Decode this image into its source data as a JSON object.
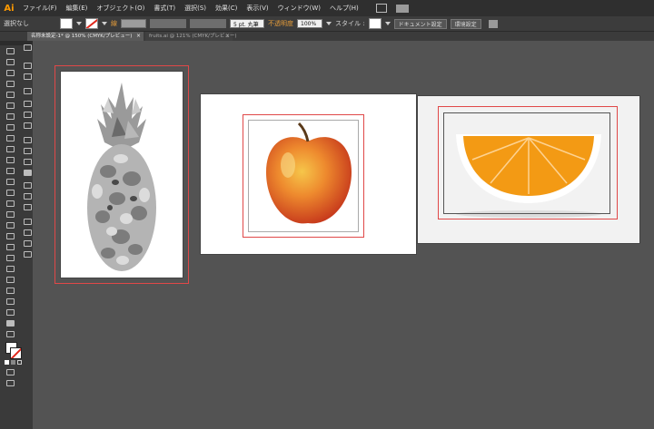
{
  "app": {
    "logo": "Ai"
  },
  "menu": {
    "items": [
      "ファイル(F)",
      "編集(E)",
      "オブジェクト(O)",
      "書式(T)",
      "選択(S)",
      "効果(C)",
      "表示(V)",
      "ウィンドウ(W)",
      "ヘルプ(H)"
    ]
  },
  "control_bar": {
    "selection_label": "選択なし",
    "stroke_label": "線",
    "brush_value": "5 pt. 丸筆",
    "opacity_label": "不透明度",
    "opacity_value": "100%",
    "style_label": "スタイル :",
    "doc_setup_button": "ドキュメント設定",
    "preferences_button": "環境設定"
  },
  "tabs": [
    {
      "label": "名称未設定-1* @ 150% (CMYK/プレビュー)",
      "active": true,
      "close": "×"
    },
    {
      "label": "fruits.ai @ 121% (CMYK/プレビュー)",
      "active": false,
      "close": "×"
    }
  ],
  "tools": {
    "icons": [
      "selection-tool-icon",
      "direct-selection-tool-icon",
      "magic-wand-icon",
      "lasso-icon",
      "pen-icon",
      "type-icon",
      "line-icon",
      "rectangle-icon",
      "paintbrush-icon",
      "pencil-icon",
      "eraser-icon",
      "rotate-icon",
      "scale-icon",
      "width-icon",
      "free-transform-icon",
      "shape-builder-icon",
      "perspective-grid-icon",
      "mesh-icon",
      "gradient-icon",
      "eyedropper-icon",
      "blend-icon",
      "symbol-sprayer-icon",
      "column-graph-icon",
      "artboard-icon",
      "slice-icon",
      "hand-icon",
      "zoom-icon"
    ]
  },
  "panel_icons": [
    "artboards-icon",
    "align-icon",
    "transform-icon",
    "pathfinder-icon",
    "paragraph-icon",
    "character-icon",
    "opentype-icon",
    "stroke-icon",
    "gradient-panel-icon",
    "transparency-icon",
    "color-icon",
    "swatches-icon",
    "brushes-icon",
    "symbols-icon",
    "graphic-styles-icon",
    "appearance-icon",
    "layers-icon",
    "links-icon"
  ],
  "colors": {
    "menubar_bg": "#2f2f2f",
    "workspace_bg": "#535353",
    "accent_orange": "#e39b3a",
    "artboard_bleed": "#e04848"
  }
}
